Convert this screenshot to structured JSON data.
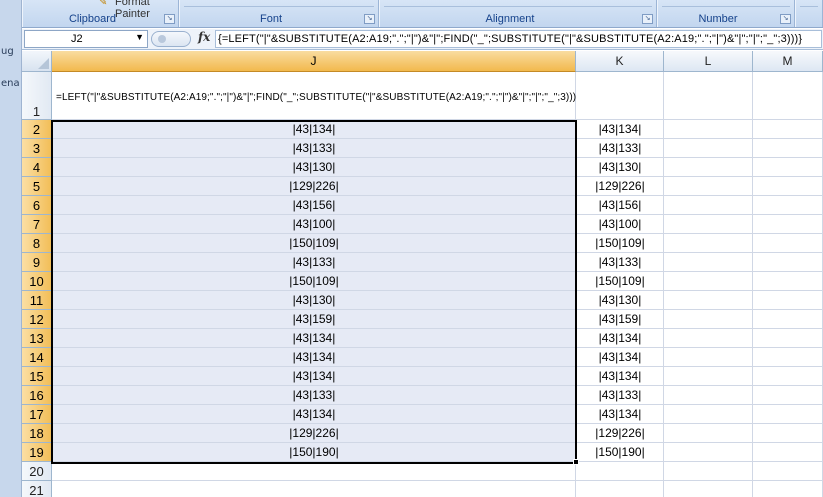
{
  "ribbon": {
    "format_painter": "Format Painter",
    "groups": [
      "Clipboard",
      "Font",
      "Alignment",
      "Number"
    ]
  },
  "window_edge": {
    "frag_1": "ug",
    "frag_2": "ena"
  },
  "formula_bar": {
    "name_box": "J2",
    "fx_label": "fx",
    "formula": "{=LEFT(\"|\"&SUBSTITUTE(A2:A19;\".\";\"|\")&\"|\";FIND(\"_\";SUBSTITUTE(\"|\"&SUBSTITUTE(A2:A19;\".\";\"|\")&\"|\";\"|\";\"_\";3)))}"
  },
  "sheet": {
    "columns": [
      "J",
      "K",
      "L",
      "M"
    ],
    "selected_column": "J",
    "row_numbers": [
      "1",
      "2",
      "3",
      "4",
      "5",
      "6",
      "7",
      "8",
      "9",
      "10",
      "11",
      "12",
      "13",
      "14",
      "15",
      "16",
      "17",
      "18",
      "19",
      "20",
      "21"
    ],
    "j1_text": "=LEFT(\"|\"&SUBSTITUTE(A2:A19;\".\";\"|\")&\"|\";FIND(\"_\";SUBSTITUTE(\"|\"&SUBSTITUTE(A2:A19;\".\";\"|\")&\"|\";\"|\";\"_\";3)))",
    "j_values": [
      "|43|134|",
      "|43|133|",
      "|43|130|",
      "|129|226|",
      "|43|156|",
      "|43|100|",
      "|150|109|",
      "|43|133|",
      "|150|109|",
      "|43|130|",
      "|43|159|",
      "|43|134|",
      "|43|134|",
      "|43|134|",
      "|43|133|",
      "|43|134|",
      "|129|226|",
      "|150|190|"
    ],
    "k_values": [
      "|43|134|",
      "|43|133|",
      "|43|130|",
      "|129|226|",
      "|43|156|",
      "|43|100|",
      "|150|109|",
      "|43|133|",
      "|150|109|",
      "|43|130|",
      "|43|159|",
      "|43|134|",
      "|43|134|",
      "|43|134|",
      "|43|133|",
      "|43|134|",
      "|129|226|",
      "|150|190|"
    ]
  },
  "colors": {
    "selection_fill": "#e6eaf5",
    "header_selected": "#f2b94d",
    "gridline": "#d0d7e5"
  }
}
